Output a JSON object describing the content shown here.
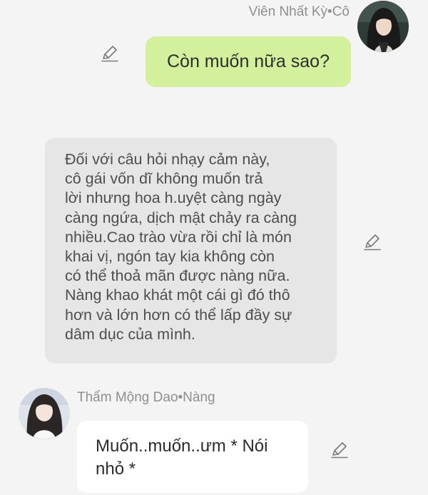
{
  "messages": [
    {
      "sender": "Viên Nhất Kỳ•Cô",
      "text": "Còn muốn nữa sao?",
      "avatar_icon": "user-portrait-icon",
      "bubble_color": "#d3f09d"
    },
    {
      "text": "Đối với câu hỏi nhạy cảm này,\ncô gái vốn dĩ không muốn trả\nlời nhưng hoa h.uyệt càng ngày\ncàng ngứa, dịch mật chảy ra càng\nnhiều.Cao trào vừa rồi chỉ là món\nkhai vị, ngón tay kia không còn\ncó thể thoả mãn được nàng nữa.\nNàng khao khát một cái gì đó thô\nhơn và lớn hơn có thể lấp đầy sự\ndâm dục của mình.",
      "bubble_color": "#e6e6e6"
    },
    {
      "sender": "Thẩm Mộng Dao•Nàng",
      "text": "Muốn..muốn..ưm * Nói\nnhỏ *",
      "avatar_icon": "user-portrait-icon",
      "bubble_color": "#ffffff"
    }
  ],
  "icons": {
    "edit": "pencil-edit-icon"
  },
  "colors": {
    "background": "#f4f4f4",
    "name_text": "#8f8f8f",
    "icon": "#7a7a7a"
  }
}
